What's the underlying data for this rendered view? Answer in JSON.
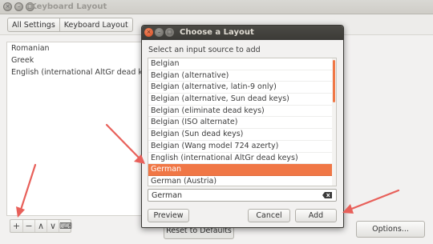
{
  "main_window": {
    "title": "Keyboard Layout",
    "breadcrumb": [
      "All Settings",
      "Keyboard Layout"
    ],
    "layouts": [
      "Romanian",
      "Greek",
      "English (international AltGr dead keys)"
    ],
    "toolbar_glyphs": [
      "+",
      "−",
      "∧",
      "∨",
      "⌨"
    ],
    "reset_label": "Reset to Defaults",
    "options_label": "Options..."
  },
  "dialog": {
    "title": "Choose a Layout",
    "heading": "Select an input source to add",
    "items": [
      "Belgian",
      "Belgian (alternative)",
      "Belgian (alternative, latin-9 only)",
      "Belgian (alternative, Sun dead keys)",
      "Belgian (eliminate dead keys)",
      "Belgian (ISO alternate)",
      "Belgian (Sun dead keys)",
      "Belgian (Wang model 724 azerty)",
      "English (international AltGr dead keys)",
      "German",
      "German (Austria)"
    ],
    "selected_item": "German",
    "search_value": "German",
    "preview_label": "Preview",
    "cancel_label": "Cancel",
    "add_label": "Add"
  },
  "colors": {
    "accent": "#f07746",
    "arrow": "#e8605a",
    "dialog_titlebar": "#3f3e3a",
    "window_bg": "#f2f1f0"
  },
  "icons": {
    "wm_close": "close-icon",
    "wm_minimize": "minimize-icon",
    "wm_maximize": "maximize-icon",
    "search_clear": "backspace-clear-icon"
  }
}
